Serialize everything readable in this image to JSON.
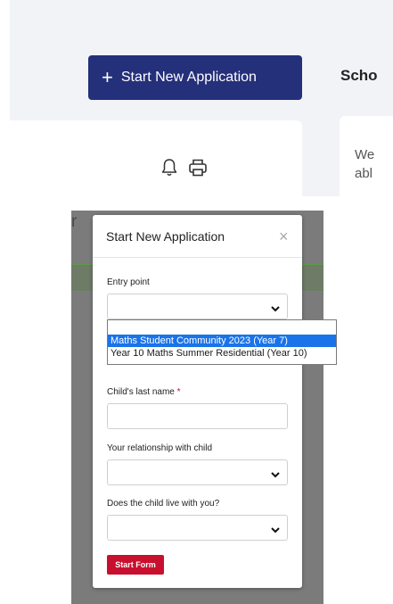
{
  "header": {
    "start_button_label": "Start New Application",
    "school_heading": "Scho"
  },
  "right_card": {
    "text_line1": "We",
    "text_line2": "abl"
  },
  "background": {
    "partial_text": "r"
  },
  "modal": {
    "title": "Start New Application",
    "close_symbol": "×",
    "fields": [
      {
        "label": "Entry point",
        "required": false,
        "type": "select",
        "value": ""
      },
      {
        "label": "Child's last name",
        "required": true,
        "type": "text",
        "value": ""
      },
      {
        "label": "Your relationship with child",
        "required": false,
        "type": "select",
        "value": ""
      },
      {
        "label": "Does the child live with you?",
        "required": false,
        "type": "select",
        "value": ""
      }
    ],
    "required_marker": "*",
    "submit_label": "Start Form"
  },
  "dropdown": {
    "options": [
      {
        "label": "Maths Student Community 2023 (Year 7)",
        "selected": true
      },
      {
        "label": "Year 10 Maths Summer Residential (Year 10)",
        "selected": false
      }
    ]
  },
  "colors": {
    "primary_button": "#25307a",
    "submit_button": "#c8102e",
    "dropdown_highlight": "#1a73e8"
  },
  "icons": [
    "plus-icon",
    "bell-icon",
    "printer-icon",
    "close-icon",
    "chevron-down-icon"
  ]
}
